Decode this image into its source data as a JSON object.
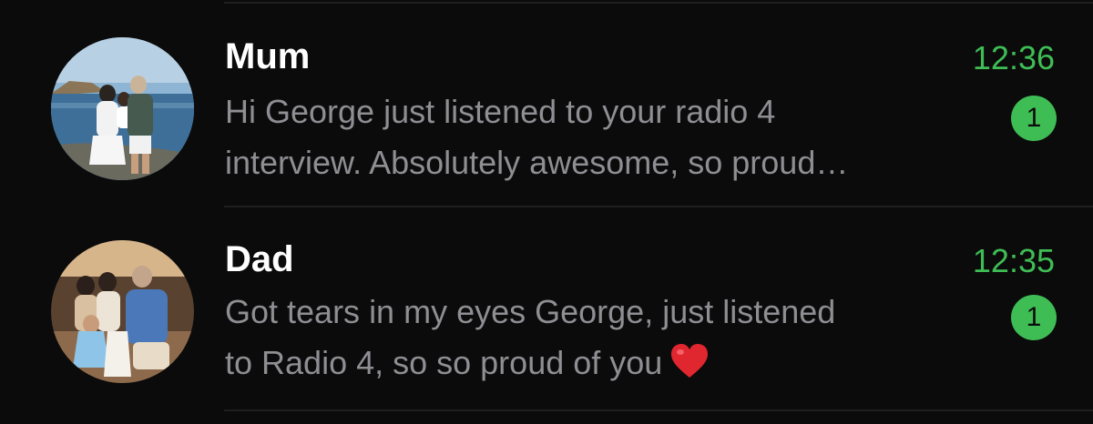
{
  "chats": [
    {
      "name": "Mum",
      "time": "12:36",
      "preview_line1": "Hi George just listened to your radio 4",
      "preview_line2": "interview. Absolutely awesome, so proud…",
      "unread_count": "1",
      "avatar": "family-photo-seaside"
    },
    {
      "name": "Dad",
      "time": "12:35",
      "preview_line1": "Got tears in my eyes George, just listened",
      "preview_line2": "to Radio 4, so so proud of you",
      "emoji": "heart-emoji",
      "unread_count": "1",
      "avatar": "family-photo-group"
    }
  ],
  "colors": {
    "background": "#0b0b0b",
    "name": "#ffffff",
    "preview": "#8e8e93",
    "accent_green": "#3fbd55",
    "divider": "#1f1f21",
    "heart": "#e0262f"
  }
}
